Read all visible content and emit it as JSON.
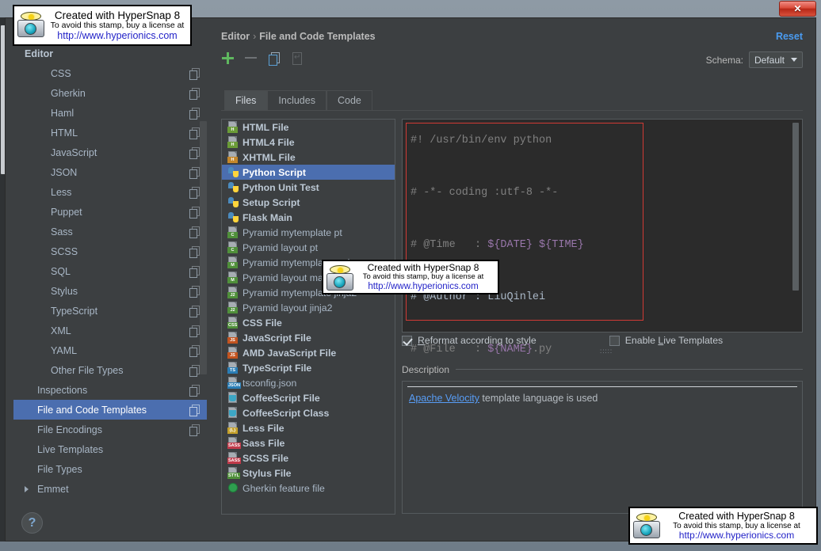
{
  "window": {
    "close_label": "✕"
  },
  "sidebar": {
    "items": [
      {
        "label": "Editor",
        "level": 0,
        "copy": false,
        "arrow": false,
        "selected": false
      },
      {
        "label": "CSS",
        "level": 1,
        "copy": true,
        "arrow": false,
        "selected": false
      },
      {
        "label": "Gherkin",
        "level": 1,
        "copy": true,
        "arrow": false,
        "selected": false
      },
      {
        "label": "Haml",
        "level": 1,
        "copy": true,
        "arrow": false,
        "selected": false
      },
      {
        "label": "HTML",
        "level": 1,
        "copy": true,
        "arrow": false,
        "selected": false
      },
      {
        "label": "JavaScript",
        "level": 1,
        "copy": true,
        "arrow": false,
        "selected": false
      },
      {
        "label": "JSON",
        "level": 1,
        "copy": true,
        "arrow": false,
        "selected": false
      },
      {
        "label": "Less",
        "level": 1,
        "copy": true,
        "arrow": false,
        "selected": false
      },
      {
        "label": "Puppet",
        "level": 1,
        "copy": true,
        "arrow": false,
        "selected": false
      },
      {
        "label": "Sass",
        "level": 1,
        "copy": true,
        "arrow": false,
        "selected": false
      },
      {
        "label": "SCSS",
        "level": 1,
        "copy": true,
        "arrow": false,
        "selected": false
      },
      {
        "label": "SQL",
        "level": 1,
        "copy": true,
        "arrow": false,
        "selected": false
      },
      {
        "label": "Stylus",
        "level": 1,
        "copy": true,
        "arrow": false,
        "selected": false
      },
      {
        "label": "TypeScript",
        "level": 1,
        "copy": true,
        "arrow": false,
        "selected": false
      },
      {
        "label": "XML",
        "level": 1,
        "copy": true,
        "arrow": false,
        "selected": false
      },
      {
        "label": "YAML",
        "level": 1,
        "copy": true,
        "arrow": false,
        "selected": false
      },
      {
        "label": "Other File Types",
        "level": 1,
        "copy": true,
        "arrow": false,
        "selected": false
      },
      {
        "label": "Inspections",
        "level": 2,
        "copy": true,
        "arrow": false,
        "selected": false
      },
      {
        "label": "File and Code Templates",
        "level": 2,
        "copy": true,
        "arrow": false,
        "selected": true
      },
      {
        "label": "File Encodings",
        "level": 2,
        "copy": true,
        "arrow": false,
        "selected": false
      },
      {
        "label": "Live Templates",
        "level": 2,
        "copy": false,
        "arrow": false,
        "selected": false
      },
      {
        "label": "File Types",
        "level": 2,
        "copy": false,
        "arrow": false,
        "selected": false
      },
      {
        "label": "Emmet",
        "level": 2,
        "copy": false,
        "arrow": true,
        "selected": false
      }
    ]
  },
  "header": {
    "breadcrumb_root": "Editor",
    "breadcrumb_sep": "›",
    "breadcrumb_leaf": "File and Code Templates",
    "reset_label": "Reset",
    "schema_label": "Schema:",
    "schema_value": "Default"
  },
  "toolbar": {
    "add_icon": "plus-icon",
    "remove_icon": "minus-icon",
    "copy_icon": "copy-icon",
    "export_icon": "export-icon"
  },
  "tabs": [
    {
      "label": "Files",
      "active": true
    },
    {
      "label": "Includes",
      "active": false
    },
    {
      "label": "Code",
      "active": false
    }
  ],
  "file_list": [
    {
      "label": "HTML File",
      "icon": "html-file-icon",
      "tag": "H",
      "tag_color": "#6a9b37",
      "bold": true,
      "selected": false
    },
    {
      "label": "HTML4 File",
      "icon": "html4-file-icon",
      "tag": "H",
      "tag_color": "#6a9b37",
      "bold": true,
      "selected": false
    },
    {
      "label": "XHTML File",
      "icon": "xhtml-file-icon",
      "tag": "H",
      "tag_color": "#c4872a",
      "bold": true,
      "selected": false
    },
    {
      "label": "Python Script",
      "icon": "python-file-icon",
      "tag": "",
      "tag_color": "",
      "bold": true,
      "selected": true
    },
    {
      "label": "Python Unit Test",
      "icon": "python-file-icon",
      "tag": "",
      "tag_color": "",
      "bold": true,
      "selected": false
    },
    {
      "label": "Setup Script",
      "icon": "python-file-icon",
      "tag": "",
      "tag_color": "",
      "bold": true,
      "selected": false
    },
    {
      "label": "Flask Main",
      "icon": "python-file-icon",
      "tag": "",
      "tag_color": "",
      "bold": true,
      "selected": false
    },
    {
      "label": "Pyramid mytemplate pt",
      "icon": "chameleon-file-icon",
      "tag": "C",
      "tag_color": "#4f8f3a",
      "bold": false,
      "selected": false
    },
    {
      "label": "Pyramid layout pt",
      "icon": "chameleon-file-icon",
      "tag": "C",
      "tag_color": "#4f8f3a",
      "bold": false,
      "selected": false
    },
    {
      "label": "Pyramid mytemplate mako",
      "icon": "mako-file-icon",
      "tag": "M",
      "tag_color": "#4f8f3a",
      "bold": false,
      "selected": false
    },
    {
      "label": "Pyramid layout mako",
      "icon": "mako-file-icon",
      "tag": "M",
      "tag_color": "#4f8f3a",
      "bold": false,
      "selected": false
    },
    {
      "label": "Pyramid mytemplate jinja2",
      "icon": "jinja2-file-icon",
      "tag": "J2",
      "tag_color": "#4f8f3a",
      "bold": false,
      "selected": false
    },
    {
      "label": "Pyramid layout jinja2",
      "icon": "jinja2-file-icon",
      "tag": "J2",
      "tag_color": "#4f8f3a",
      "bold": false,
      "selected": false
    },
    {
      "label": "CSS File",
      "icon": "css-file-icon",
      "tag": "CSS",
      "tag_color": "#4f8f3a",
      "bold": true,
      "selected": false
    },
    {
      "label": "JavaScript File",
      "icon": "js-file-icon",
      "tag": "JS",
      "tag_color": "#c2531f",
      "bold": true,
      "selected": false
    },
    {
      "label": "AMD JavaScript File",
      "icon": "js-file-icon",
      "tag": "JS",
      "tag_color": "#c2531f",
      "bold": true,
      "selected": false
    },
    {
      "label": "TypeScript File",
      "icon": "ts-file-icon",
      "tag": "TS",
      "tag_color": "#2a7db5",
      "bold": true,
      "selected": false
    },
    {
      "label": "tsconfig.json",
      "icon": "json-file-icon",
      "tag": "JSON",
      "tag_color": "#2a7db5",
      "bold": false,
      "selected": false
    },
    {
      "label": "CoffeeScript File",
      "icon": "coffee-file-icon",
      "tag": "",
      "tag_color": "",
      "bold": true,
      "selected": false
    },
    {
      "label": "CoffeeScript Class",
      "icon": "coffee-file-icon",
      "tag": "",
      "tag_color": "",
      "bold": true,
      "selected": false
    },
    {
      "label": "Less File",
      "icon": "less-file-icon",
      "tag": "{L}",
      "tag_color": "#c4a02a",
      "bold": true,
      "selected": false
    },
    {
      "label": "Sass File",
      "icon": "sass-file-icon",
      "tag": "SASS",
      "tag_color": "#c03a4a",
      "bold": true,
      "selected": false
    },
    {
      "label": "SCSS File",
      "icon": "scss-file-icon",
      "tag": "SASS",
      "tag_color": "#c03a4a",
      "bold": true,
      "selected": false
    },
    {
      "label": "Stylus File",
      "icon": "stylus-file-icon",
      "tag": "STYL",
      "tag_color": "#4f8f3a",
      "bold": true,
      "selected": false
    },
    {
      "label": "Gherkin feature file",
      "icon": "gherkin-file-icon",
      "tag": "",
      "tag_color": "",
      "bold": false,
      "selected": false
    }
  ],
  "editor": {
    "lines": [
      {
        "plain": "#! /usr/bin/env python"
      },
      {
        "plain": ""
      },
      {
        "plain": "# -*- coding :utf-8 -*-"
      },
      {
        "plain": ""
      },
      {
        "plain": "# @Time   : ",
        "var": "${DATE} ${TIME}"
      },
      {
        "plain": ""
      },
      {
        "plain": "# @Author : ",
        "text": "LiuQinlei"
      },
      {
        "plain": ""
      },
      {
        "plain": "# @File   : ",
        "var": "${NAME}",
        "tail": ".py"
      }
    ],
    "full_text": "#! /usr/bin/env python\n\n# -*- coding :utf-8 -*-\n\n# @Time   : ${DATE} ${TIME}\n\n# @Author : LiuQinlei\n\n# @File   : ${NAME}.py"
  },
  "options": {
    "reformat_label": "Reformat according to style",
    "reformat_checked": true,
    "live_templates_label": "Enable Live Templates",
    "live_templates_checked": false
  },
  "description": {
    "legend": "Description",
    "link_text": "Apache Velocity",
    "rest_text": " template language is used"
  },
  "footer": {
    "help_label": "?"
  },
  "stamps": {
    "line1": "Created with HyperSnap 8",
    "line2": "To avoid this stamp, buy a license at",
    "line3": "http://www.hyperionics.com"
  },
  "colors": {
    "accent_selection": "#4b6eaf",
    "link": "#589df6",
    "reset": "#4a9bf0",
    "panel_bg": "#3c3f41",
    "editor_bg": "#2b2b2b",
    "red_outline": "#d03a35",
    "velocity_var": "#9876aa"
  }
}
